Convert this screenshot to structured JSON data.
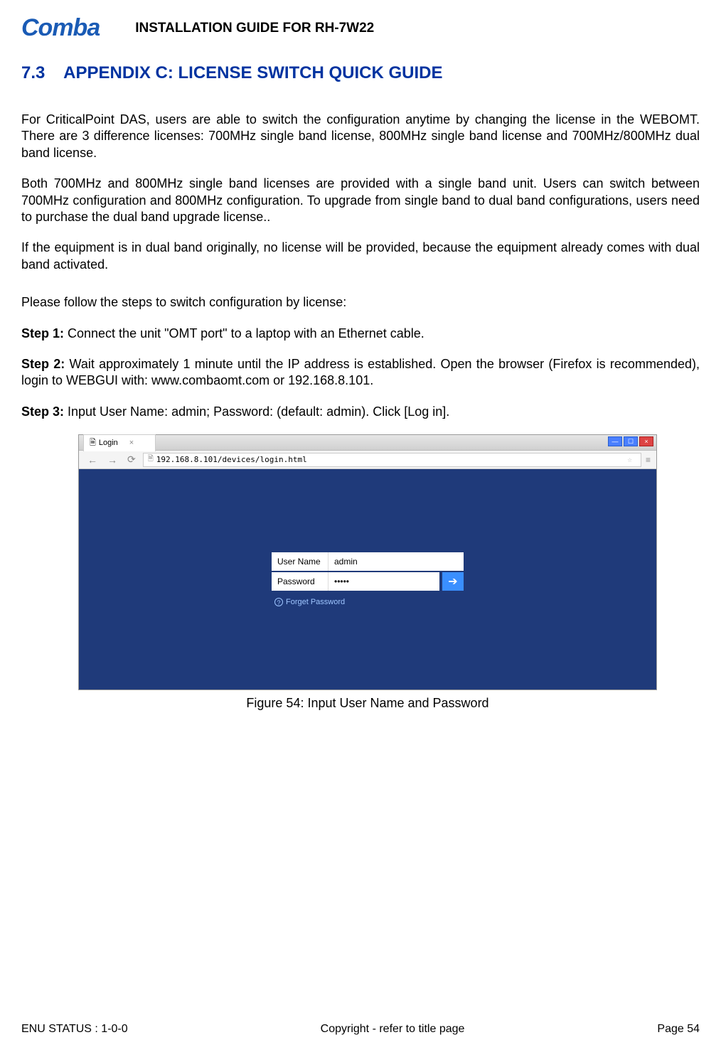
{
  "header": {
    "logo_text": "Comba",
    "doc_title": "INSTALLATION GUIDE FOR RH-7W22"
  },
  "section": {
    "number": "7.3",
    "title": "APPENDIX C: LICENSE SWITCH QUICK GUIDE"
  },
  "paragraphs": {
    "p1": "For CriticalPoint DAS, users are able to switch the configuration anytime by changing the license in the WEBOMT. There are 3 difference licenses: 700MHz single band license, 800MHz single band license and 700MHz/800MHz dual band license.",
    "p2": "Both 700MHz and 800MHz single band licenses are provided with a single band unit. Users can switch between 700MHz configuration and 800MHz configuration. To upgrade from single band to dual band configurations, users need to purchase the dual band upgrade license..",
    "p3": "If the equipment is in dual band originally, no license will be provided, because the equipment already comes with dual band activated.",
    "p4": "Please follow the steps to switch configuration by license:"
  },
  "steps": {
    "s1_label": "Step 1:",
    "s1_text": " Connect the unit \"OMT port\" to a laptop with an Ethernet cable.",
    "s2_label": "Step 2:",
    "s2_text": " Wait approximately 1 minute until the IP address is established. Open the browser (Firefox is recommended), login to WEBGUI with: www.combaomt.com or 192.168.8.101.",
    "s3_label": "Step 3:",
    "s3_text": " Input User Name: admin; Password: (default: admin). Click [Log in]."
  },
  "screenshot": {
    "tab_title": "Login",
    "url": "192.168.8.101/devices/login.html",
    "login": {
      "username_label": "User Name",
      "username_value": "admin",
      "password_label": "Password",
      "password_value": "•••••",
      "forget": "Forget Password"
    }
  },
  "figure_caption": "Figure 54: Input User Name and Password",
  "footer": {
    "left": "ENU STATUS : 1-0-0",
    "center": "Copyright - refer to title page",
    "right": "Page 54"
  }
}
